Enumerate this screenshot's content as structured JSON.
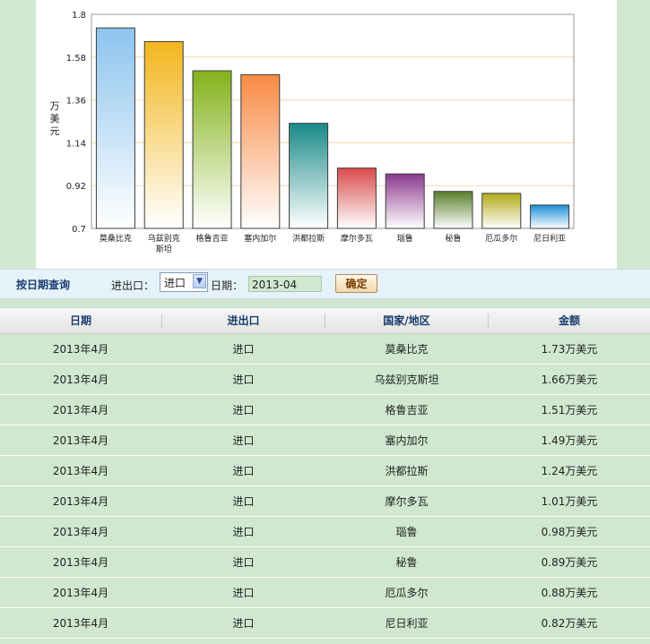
{
  "chart_data": {
    "type": "bar",
    "ylabel": "万美元",
    "ylim": [
      0.7,
      1.8
    ],
    "yticks": [
      "0.7",
      "0.92",
      "1.14",
      "1.36",
      "1.58",
      "1.8"
    ],
    "ytick_values": [
      0.7,
      0.92,
      1.14,
      1.36,
      1.58,
      1.8
    ],
    "grid": true,
    "categories": [
      "莫桑比克",
      "乌兹别克斯坦",
      "格鲁吉亚",
      "塞内加尔",
      "洪都拉斯",
      "摩尔多瓦",
      "瑙鲁",
      "秘鲁",
      "厄瓜多尔",
      "尼日利亚"
    ],
    "category_label_lines": [
      [
        "莫桑比克"
      ],
      [
        "乌兹别克",
        "斯坦"
      ],
      [
        "格鲁吉亚"
      ],
      [
        "塞内加尔"
      ],
      [
        "洪都拉斯"
      ],
      [
        "摩尔多瓦"
      ],
      [
        "瑙鲁"
      ],
      [
        "秘鲁"
      ],
      [
        "厄瓜多尔"
      ],
      [
        "尼日利亚"
      ]
    ],
    "values": [
      1.73,
      1.66,
      1.51,
      1.49,
      1.24,
      1.01,
      0.98,
      0.89,
      0.88,
      0.82
    ],
    "colors": [
      "#8cc3ee",
      "#f2b61c",
      "#83b21a",
      "#f98a45",
      "#1a8a88",
      "#d94b4b",
      "#8b3a8e",
      "#587d2a",
      "#b2aa18",
      "#1b8ed6"
    ]
  },
  "query": {
    "title": "按日期查询",
    "io_label": "进出口：",
    "io_value": "进口",
    "date_label": "日期：",
    "date_value": "2013-04",
    "confirm_label": "确定"
  },
  "table": {
    "headers": [
      "日期",
      "进出口",
      "国家/地区",
      "金额"
    ],
    "rows": [
      [
        "2013年4月",
        "进口",
        "莫桑比克",
        "1.73万美元"
      ],
      [
        "2013年4月",
        "进口",
        "乌兹别克斯坦",
        "1.66万美元"
      ],
      [
        "2013年4月",
        "进口",
        "格鲁吉亚",
        "1.51万美元"
      ],
      [
        "2013年4月",
        "进口",
        "塞内加尔",
        "1.49万美元"
      ],
      [
        "2013年4月",
        "进口",
        "洪都拉斯",
        "1.24万美元"
      ],
      [
        "2013年4月",
        "进口",
        "摩尔多瓦",
        "1.01万美元"
      ],
      [
        "2013年4月",
        "进口",
        "瑙鲁",
        "0.98万美元"
      ],
      [
        "2013年4月",
        "进口",
        "秘鲁",
        "0.89万美元"
      ],
      [
        "2013年4月",
        "进口",
        "厄瓜多尔",
        "0.88万美元"
      ],
      [
        "2013年4月",
        "进口",
        "尼日利亚",
        "0.82万美元"
      ]
    ]
  }
}
